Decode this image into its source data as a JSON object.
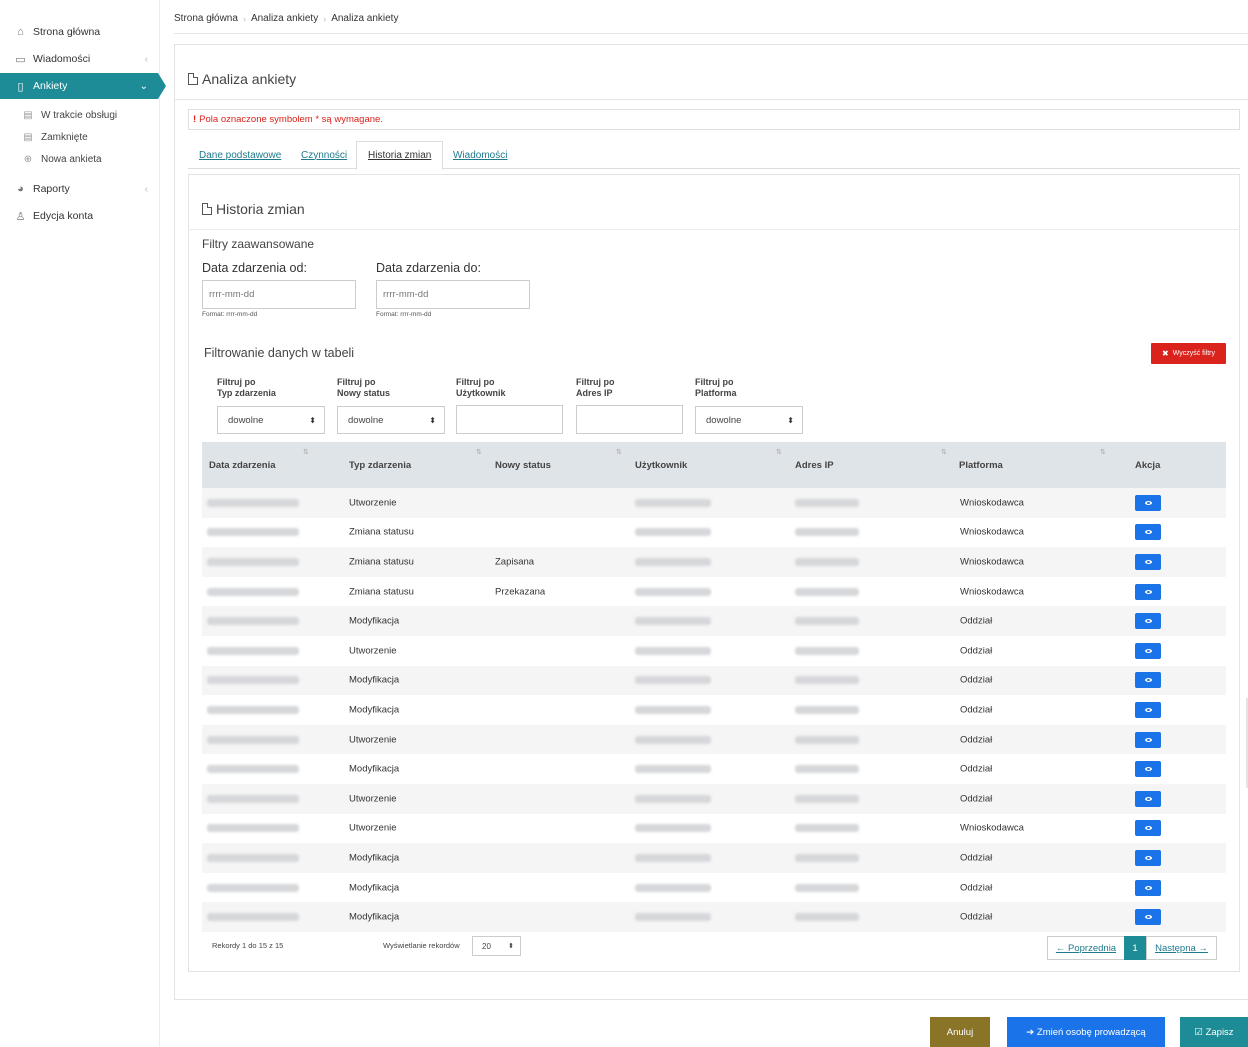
{
  "sidebar": {
    "items": [
      {
        "label": "Strona główna",
        "icon": "home-icon"
      },
      {
        "label": "Wiadomości",
        "icon": "inbox-icon"
      },
      {
        "label": "Ankiety",
        "icon": "document-icon"
      },
      {
        "label": "Raporty",
        "icon": "pie-chart-icon"
      },
      {
        "label": "Edycja konta",
        "icon": "user-icon"
      }
    ],
    "subitems": [
      {
        "label": "W trakcie obsługi",
        "icon": "file-icon"
      },
      {
        "label": "Zamknięte",
        "icon": "file-icon"
      },
      {
        "label": "Nowa ankieta",
        "icon": "circle-plus-icon"
      }
    ]
  },
  "breadcrumb": [
    "Strona główna",
    "Analiza ankiety",
    "Analiza ankiety"
  ],
  "page": {
    "title": "Analiza ankiety",
    "notice_mark": "!",
    "notice": "Pola oznaczone symbolem * są wymagane."
  },
  "tabs": [
    "Dane podstawowe",
    "Czynności",
    "Historia zmian",
    "Wiadomości"
  ],
  "section": {
    "title": "Historia zmian",
    "advanced_filters": "Filtry zaawansowane",
    "date_from_label": "Data zdarzenia od:",
    "date_to_label": "Data zdarzenia do:",
    "date_placeholder": "rrrr-mm-dd",
    "date_format": "Format: rrrr-mm-dd",
    "table_filter_title": "Filtrowanie danych w tabeli",
    "clear_filters": "Wyczyść filtry"
  },
  "filters": [
    {
      "line1": "Filtruj po",
      "line2": "Typ zdarzenia",
      "type": "select",
      "value": "dowolne"
    },
    {
      "line1": "Filtruj po",
      "line2": "Nowy status",
      "type": "select",
      "value": "dowolne"
    },
    {
      "line1": "Filtruj po",
      "line2": "Użytkownik",
      "type": "input",
      "value": ""
    },
    {
      "line1": "Filtruj po",
      "line2": "Adres IP",
      "type": "input",
      "value": ""
    },
    {
      "line1": "Filtruj po",
      "line2": "Platforma",
      "type": "select",
      "value": "dowolne"
    }
  ],
  "table": {
    "columns": [
      "Data zdarzenia",
      "Typ zdarzenia",
      "Nowy status",
      "Użytkownik",
      "Adres IP",
      "Platforma",
      "Akcja"
    ],
    "rows": [
      {
        "type": "Utworzenie",
        "status": "",
        "platform": "Wnioskodawca"
      },
      {
        "type": "Zmiana statusu",
        "status": "",
        "platform": "Wnioskodawca"
      },
      {
        "type": "Zmiana statusu",
        "status": "Zapisana",
        "platform": "Wnioskodawca"
      },
      {
        "type": "Zmiana statusu",
        "status": "Przekazana",
        "platform": "Wnioskodawca"
      },
      {
        "type": "Modyfikacja",
        "status": "",
        "platform": "Oddział"
      },
      {
        "type": "Utworzenie",
        "status": "",
        "platform": "Oddział"
      },
      {
        "type": "Modyfikacja",
        "status": "",
        "platform": "Oddział"
      },
      {
        "type": "Modyfikacja",
        "status": "",
        "platform": "Oddział"
      },
      {
        "type": "Utworzenie",
        "status": "",
        "platform": "Oddział"
      },
      {
        "type": "Modyfikacja",
        "status": "",
        "platform": "Oddział"
      },
      {
        "type": "Utworzenie",
        "status": "",
        "platform": "Oddział"
      },
      {
        "type": "Utworzenie",
        "status": "",
        "platform": "Wnioskodawca"
      },
      {
        "type": "Modyfikacja",
        "status": "",
        "platform": "Oddział"
      },
      {
        "type": "Modyfikacja",
        "status": "",
        "platform": "Oddział"
      },
      {
        "type": "Modyfikacja",
        "status": "",
        "platform": "Oddział"
      }
    ],
    "records_info": "Rekordy 1 do 15 z 15",
    "per_page_label": "Wyświetlanie rekordów",
    "per_page_value": "20"
  },
  "pagination": {
    "prev": "← Poprzednia",
    "current": "1",
    "next": "Następna →"
  },
  "actions": {
    "cancel": "Anuluj",
    "change_owner": "➔ Zmień osobę prowadzącą",
    "save": "☑ Zapisz"
  },
  "colors": {
    "accent": "#1e8c96",
    "primary": "#1a73e8",
    "danger": "#d9231c",
    "cancel": "#8a7428",
    "table_header": "#dfe4e8"
  }
}
